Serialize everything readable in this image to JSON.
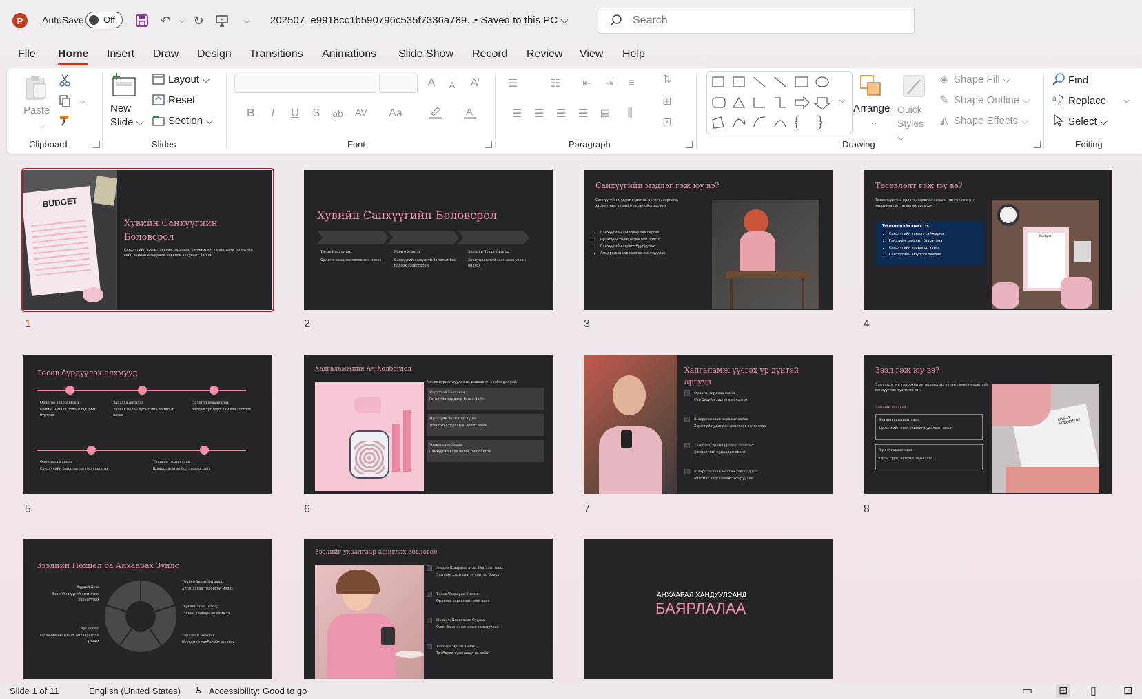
{
  "titlebar": {
    "app_logo": "P",
    "autosave_label": "AutoSave",
    "autosave_state": "Off",
    "doc_title": "202507_e9918cc1b590796c535f7336a789...",
    "saved_status": "• Saved to this PC ⌵",
    "search_placeholder": "Search"
  },
  "tabs": [
    "File",
    "Home",
    "Insert",
    "Draw",
    "Design",
    "Transitions",
    "Animations",
    "Slide Show",
    "Record",
    "Review",
    "View",
    "Help"
  ],
  "ribbon": {
    "clipboard": {
      "label": "Clipboard",
      "paste": "Paste"
    },
    "slides": {
      "label": "Slides",
      "new": "New",
      "slide": "Slide ⌵",
      "layout": "Layout ⌵",
      "reset": "Reset",
      "section": "Section ⌵"
    },
    "font": {
      "label": "Font",
      "bold": "B",
      "italic": "I",
      "underline": "U",
      "shadow": "S",
      "strike": "ab",
      "spacing": "AV",
      "case": "Aa",
      "grow": "A",
      "shrink": "A"
    },
    "paragraph": {
      "label": "Paragraph"
    },
    "drawing": {
      "label": "Drawing",
      "arrange": "Arrange",
      "quick_styles": "Quick Styles ⌵",
      "shape_fill": "Shape Fill ⌵",
      "shape_outline": "Shape Outline ⌵",
      "shape_effects": "Shape Effects ⌵"
    },
    "editing": {
      "label": "Editing",
      "find": "Find",
      "replace": "Replace",
      "select": "Select ⌵"
    }
  },
  "slides": [
    {
      "num": "1",
      "title": "Хувийн Санхүүгийн Боловсрол",
      "body": "Санхүүгийн ажлыг зөвхөн зардлаар хэмжихгүй, харин таны ирээдүйн сайн сайхан амьдралд хөрөнгө оруулалт болно.",
      "image_text": "BUDGET"
    },
    {
      "num": "2",
      "title": "Хувийн Санхүүгийн Боловсрол",
      "cols": [
        {
          "h": "Төсөв Бүрдүүлэх",
          "t": "Орлого, зардлаа төлөвлөх, хянах"
        },
        {
          "h": "Мөнгө Хэмнэх",
          "t": "Санхүүгийн аюулгүй байдлыг бий болгох зорилготой"
        },
        {
          "h": "Зээлийн Тухай Ойлгох",
          "t": "Хариуцлагатай зээл авах ухаан ойлгох"
        }
      ]
    },
    {
      "num": "3",
      "title": "Санхүүгийн мэдлэг гэж юу вэ?",
      "body": "Санхүүгийн мэдлэг гэдэг нь орлого, зарлага, хуримтлал, зээлийн тухай ойлголт юм.",
      "bullets": [
        "Санхүүгийн шийдвэр зөв гаргах",
        "Ирээдүйн төлөвлөгөө бий болгох",
        "Санхүүгийн стресс бууруулах",
        "Амьдралын хэв маягаа сайжруулах"
      ]
    },
    {
      "num": "4",
      "title": "Төсөвлөлт гэж юу вэ?",
      "body": "Төсөв гэдэг нь орлого, зардлаа хянаж, мөнгөө хэрхэн зарцуулахыг төлөвлөх арга юм.",
      "box_title": "Төсөвлөлтийн ашиг тус",
      "bullets": [
        "Санхүүгийн хяналт сайжирна",
        "Гэнэтийн зардлыг бууруулна",
        "Санхүүгийн зорилгод хүрэх",
        "Санхүүгийн аюулгүй байдал"
      ],
      "image_text": "Budget"
    },
    {
      "num": "5",
      "title": "Төсөв бүрдүүлэх алхмууд",
      "steps": [
        {
          "h": "Орлогоо тодорхойлох",
          "t": "Цалин, нэмэлт орлого бүгдийг бүртгэх"
        },
        {
          "h": "Зардлаа ангилах",
          "t": "Заавал болон хүсэлтийн зардлыг ялгах"
        },
        {
          "h": "Орлогоо хуваарилах",
          "t": "Зардал тус бүрт хэмжээ тогтоох"
        },
        {
          "h": "Өдөр тутам хянах",
          "t": "Санхүүгийн байдлаа тогтмол шалгах"
        },
        {
          "h": "Тогтмол тохируулах",
          "t": "Шаардлагатай бол засвар хийх"
        }
      ]
    },
    {
      "num": "6",
      "title": "Хадгаламжийн Ач Холбогдол",
      "body": "Мөнгө хуримтлуулах нь дараах ач холбогдолтой.",
      "items": [
        {
          "h": "Яаралтай Баталгаа",
          "t": "Гэнэтийн зардалд бэлэн байх"
        },
        {
          "h": "Ирээдүйн Зорилгод Хүрэх",
          "t": "Томоохон худалдан авалт хийх"
        },
        {
          "h": "Зорилгодоо Хүрэх",
          "t": "Санхүүгийн эрх чөлөө бий болгох"
        }
      ]
    },
    {
      "num": "7",
      "title": "Хадгаламж үүсгэх үр дүнтэй аргууд",
      "items": [
        {
          "h": "Орлого, зардлаа хянах",
          "t": "Сар бүрийн зарлагаа бүртгэх"
        },
        {
          "h": "Шаардлагатай зардлыг хасах",
          "t": "Хэрэггүй худалдан авалтаас татгалзах"
        },
        {
          "h": "Хямдрал, урамшууллыг ашиглах",
          "t": "Хэмнэлттэй худалдан авалт"
        },
        {
          "h": "Шаардлагатай мөнгөө хойшлуулах",
          "t": "Автомат хадгаламж тохируулах"
        }
      ]
    },
    {
      "num": "8",
      "title": "Зээл гэж юу вэ?",
      "body": "Зээл гэдэг нь тодорхой хугацаанд эргүүлэн төлөх нөхцөлтэй санхүүгийн тусламж юм.",
      "sub": "Зээлийн төрлүүд",
      "boxes": [
        {
          "h": "Богино хугацаат зээл",
          "t": "Цалингийн зээл, жижиг худалдан авалт"
        },
        {
          "h": "Урт хугацаат зээл",
          "t": "Орон сууц, автомашины зээл"
        }
      ],
      "image_text": "CREDIT AGREEMENT"
    },
    {
      "num": "9",
      "title": "Зээлийн Нөхцөл ба Анхаарах Зүйлс",
      "labels": [
        {
          "h": "Хүүний Хувь",
          "t": "Зээлийн хүүгийн хэмжээг харьцуулах"
        },
        {
          "h": "Төлбөр Төлөх Хугацаа",
          "t": "Хугацаагаа тодорхой мэдэх"
        },
        {
          "h": "Урьдчилгаа Төлбөр",
          "t": "Эхний төлбөрийн хэмжээ"
        },
        {
          "h": "Эрсдэлүүд",
          "t": "Гэрээний нөхцлийг анхааралтай унших"
        },
        {
          "h": "Гэрээний Нөхцөл",
          "t": "Нуугдмал төлбөрийг шалгах"
        }
      ]
    },
    {
      "num": "10",
      "title": "Зээлийг ухаалгаар ашиглах зөвлөгөө",
      "items": [
        {
          "h": "Зөвхөн Шаардлагатай Үед Зээл Авах",
          "t": "Зээлийн хэрэгцээгээ сайтар бодох"
        },
        {
          "h": "Төлөх Чадвараа Үнэлэх",
          "t": "Орлогоо харгалзан зээл авах"
        },
        {
          "h": "Нөхцөл, Хөнгөлөлт Судлах",
          "t": "Олон банкны саналыг харьцуулах"
        },
        {
          "h": "Тогтмол Эргэн Төлөх",
          "t": "Төлбөрөө хугацаанд нь хийх"
        }
      ]
    },
    {
      "num": "11",
      "pre": "АНХААРАЛ ХАНДУУЛСАНД",
      "title": "БАЯРЛАЛАА"
    }
  ],
  "status": {
    "slide_count": "Slide 1 of 11",
    "language": "English (United States)",
    "accessibility": "Accessibility: Good to go"
  }
}
